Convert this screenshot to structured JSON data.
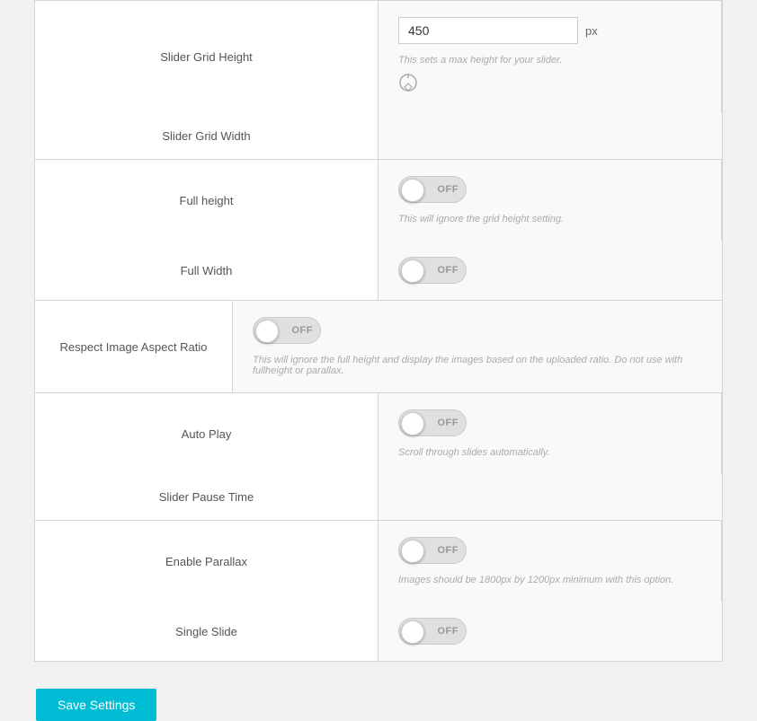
{
  "rows": {
    "slider_grid_height": {
      "label": "Slider Grid Height",
      "value": "450",
      "unit": "px",
      "description": "This sets a max height for your slider."
    },
    "slider_grid_width": {
      "label": "Slider Grid Width"
    },
    "full_height": {
      "label": "Full height",
      "toggle_state": "OFF",
      "description": "This will ignore the grid height setting."
    },
    "full_width": {
      "label": "Full Width",
      "toggle_state": "OFF"
    },
    "respect_image_aspect_ratio": {
      "label": "Respect Image Aspect Ratio",
      "toggle_state": "OFF",
      "description": "This will ignore the full height and display the images based on the uploaded ratio. Do not use with fullheight or parallax."
    },
    "auto_play": {
      "label": "Auto Play",
      "toggle_state": "OFF",
      "description": "Scroll through slides automatically."
    },
    "slider_pause_time": {
      "label": "Slider Pause Time"
    },
    "enable_parallax": {
      "label": "Enable Parallax",
      "toggle_state": "OFF",
      "description": "Images should be 1800px by 1200px minimum with this option."
    },
    "single_slide": {
      "label": "Single Slide",
      "toggle_state": "OFF"
    }
  },
  "buttons": {
    "save_settings": "Save Settings"
  }
}
